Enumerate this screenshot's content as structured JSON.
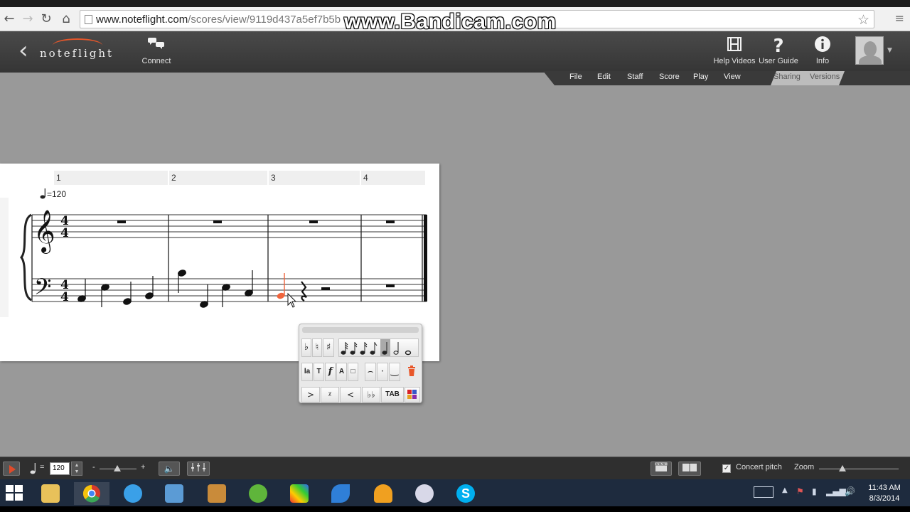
{
  "browser": {
    "url_host": "www.noteflight.com",
    "url_path": "/scores/view/9119d437a5ef7b5b",
    "watermark": "www.Bandicam.com",
    "back_icon": "back-arrow-icon",
    "forward_icon": "forward-arrow-icon",
    "reload_icon": "reload-icon",
    "home_icon": "home-icon",
    "bookmark_icon": "star-icon",
    "menu_icon": "chrome-menu-icon"
  },
  "header": {
    "logo": "noteflight",
    "connect_label": "Connect",
    "help_videos_label": "Help Videos",
    "user_guide_label": "User Guide",
    "info_label": "Info",
    "help_videos_icon": "film-icon",
    "user_guide_icon": "question-icon",
    "info_icon": "info-icon",
    "connect_icon": "chat-bubbles-icon"
  },
  "menu": {
    "items": [
      "File",
      "Edit",
      "Staff",
      "Score",
      "Play",
      "View"
    ],
    "tabs": [
      "Sharing",
      "Versions"
    ]
  },
  "score": {
    "measures": [
      "1",
      "2",
      "3",
      "4"
    ],
    "tempo_marking": "=120",
    "time_signature": "4/4",
    "treble_clef": "𝄞",
    "bass_clef": "𝄢",
    "selected_note_color": "#f0643c"
  },
  "palette": {
    "row1": [
      "♭",
      "♮",
      "♯"
    ],
    "row2_text": [
      "la",
      "T",
      "𝆑",
      "A",
      "□"
    ],
    "row3_tab": "TAB",
    "delete_icon": "trash-icon",
    "colors_icon": "color-grid-icon"
  },
  "playback": {
    "tempo_value": "120",
    "equals": "=",
    "volume_minus": "-",
    "volume_plus": "+",
    "concert_pitch_label": "Concert pitch",
    "concert_pitch_checked": true,
    "zoom_label": "Zoom",
    "play_icon": "play-icon",
    "speaker_icon": "speaker-icon",
    "mixer_icon": "mixer-icon",
    "clapper_icon": "clapper-icon",
    "book_icon": "book-icon"
  },
  "taskbar": {
    "apps": [
      "file-explorer-icon",
      "chrome-icon",
      "itunes-icon",
      "wordpad-icon",
      "paint-icon",
      "globe-icon",
      "photo-icon",
      "feather-icon",
      "headphones-icon",
      "sketch-icon",
      "skype-icon"
    ],
    "time": "11:43 AM",
    "date": "8/3/2014"
  },
  "colors": {
    "accent": "#e8572a",
    "workspace": "#999999",
    "header": "#3f3f3f"
  }
}
